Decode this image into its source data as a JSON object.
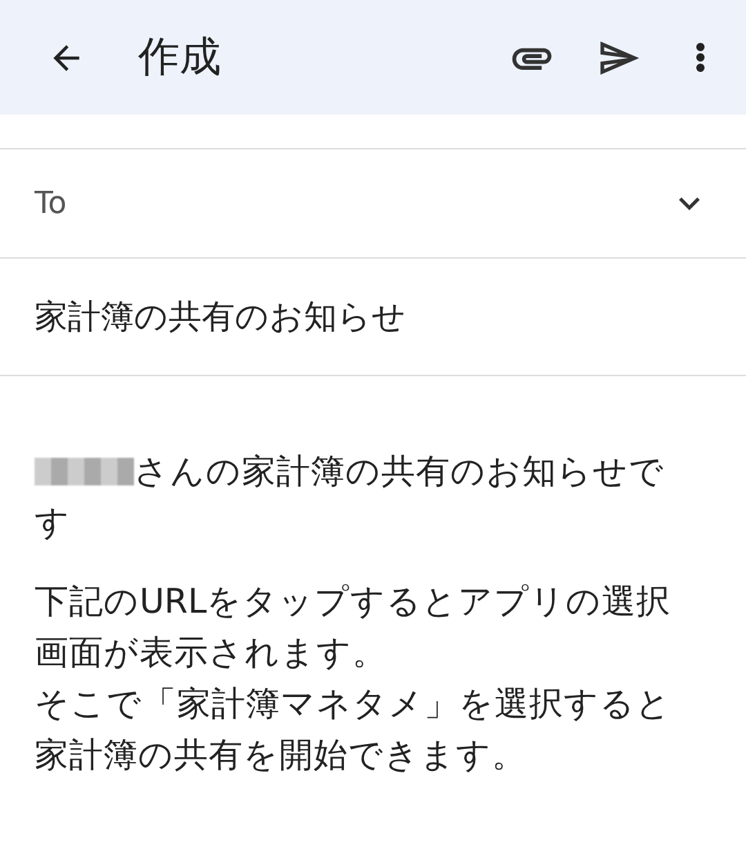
{
  "app_bar": {
    "title": "作成"
  },
  "to_field": {
    "label": "To",
    "expanded": false
  },
  "subject": {
    "value": "家計簿の共有のお知らせ"
  },
  "body": {
    "paragraphs": [
      {
        "lines": [
          {
            "kind": "after_redacted_name",
            "text": "さんの家計簿の共有のお知らせで"
          },
          {
            "kind": "plain",
            "text": "す"
          }
        ]
      },
      {
        "lines": [
          {
            "kind": "plain",
            "text": "下記のURLをタップするとアプリの選択"
          },
          {
            "kind": "plain",
            "text": "画面が表示されます。"
          },
          {
            "kind": "plain",
            "text": "そこで「家計簿マネタメ」を選択すると"
          },
          {
            "kind": "plain",
            "text": "家計簿の共有を開始できます。"
          }
        ]
      }
    ]
  }
}
